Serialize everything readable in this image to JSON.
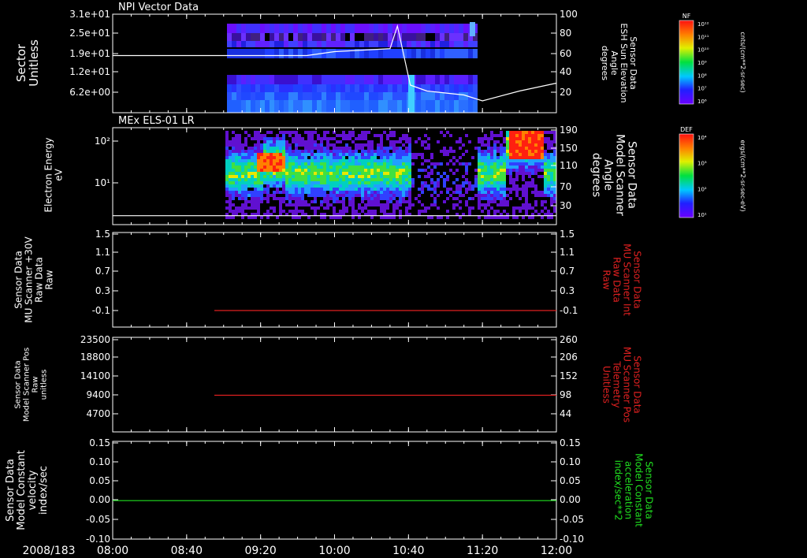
{
  "chart_data": [
    {
      "type": "heatmap",
      "title": "NPI Vector Data",
      "ylabel": [
        "Sector",
        "Unitless"
      ],
      "yticks": [
        "3.1e+01",
        "2.5e+01",
        "1.9e+01",
        "1.2e+01",
        "6.2e+00"
      ],
      "y2label": [
        "Sensor Data",
        "ESH Sun Elevation",
        "Angle",
        "degrees"
      ],
      "y2ticks": [
        "100",
        "80",
        "60",
        "40",
        "20"
      ],
      "ylim2": [
        0,
        100
      ],
      "colorbar": {
        "title": "NF",
        "unit": "cnts/(cm**2-sr-sec)",
        "ticks": [
          "10¹²",
          "10¹¹",
          "10¹⁰",
          "10⁹",
          "10⁸",
          "10⁷",
          "10⁶"
        ]
      },
      "series": [
        {
          "kind": "line",
          "x": [
            "08:00",
            "09:45",
            "10:00",
            "10:30",
            "10:34",
            "10:41",
            "10:50",
            "11:10",
            "11:20",
            "11:40",
            "12:00"
          ],
          "values": [
            58,
            58,
            62,
            65,
            88,
            28,
            22,
            18,
            12,
            22,
            30
          ]
        }
      ]
    },
    {
      "type": "heatmap",
      "title": "MEx ELS-01 LR",
      "ylabel": [
        "Electron Energy",
        "eV"
      ],
      "yticks": [
        "10²",
        "10¹"
      ],
      "y2label": [
        "Sensor Data",
        "Model Scanner",
        "Angle",
        "degrees"
      ],
      "y2ticks": [
        "190",
        "150",
        "110",
        "70",
        "30"
      ],
      "ylim2": [
        0,
        190
      ],
      "colorbar": {
        "title": "DEF",
        "unit": "ergs/(cm**2-sr-sec-eV)",
        "ticks": [
          "10⁴",
          "10³",
          "10²",
          "10¹"
        ]
      },
      "series": [
        {
          "kind": "line",
          "x": [
            "08:00",
            "12:00"
          ],
          "values": [
            2,
            2
          ]
        }
      ]
    },
    {
      "type": "line",
      "ylabel": [
        "Sensor Data",
        "MU Scanner +30V",
        "Raw Data",
        "Raw"
      ],
      "yticks": [
        "1.5",
        "1.1",
        "0.7",
        "0.3",
        "-0.1"
      ],
      "ylim": [
        -0.5,
        1.5
      ],
      "y2label": [
        "Sensor Data",
        "MU Scanner Int",
        "Raw Data",
        "Raw"
      ],
      "y2ticks": [
        "1.5",
        "1.1",
        "0.7",
        "0.3",
        "-0.1"
      ],
      "series": [
        {
          "kind": "line",
          "color": "#e02020",
          "x": [
            "08:55",
            "12:00"
          ],
          "values": [
            -0.1,
            -0.1
          ]
        }
      ]
    },
    {
      "type": "line",
      "ylabel": [
        "Sensor Data",
        "Model Scanner Pos",
        "Raw",
        "unitless"
      ],
      "yticks": [
        "23500",
        "18800",
        "14100",
        "9400",
        "4700"
      ],
      "ylim": [
        0,
        23500
      ],
      "y2label": [
        "Sensor Data",
        "MU Scanner Pos",
        "Telemetry",
        "Unitless"
      ],
      "y2ticks": [
        "260",
        "206",
        "152",
        "98",
        "44"
      ],
      "ylim2": [
        -10,
        260
      ],
      "series": [
        {
          "kind": "line",
          "color": "#e02020",
          "x": [
            "08:55",
            "12:00"
          ],
          "values2": [
            98,
            98
          ]
        }
      ]
    },
    {
      "type": "line",
      "ylabel": [
        "Sensor Data",
        "Model Constant",
        "velocity",
        "index/sec"
      ],
      "yticks": [
        "0.15",
        "0.10",
        "0.05",
        "0.00",
        "-0.05",
        "-0.10"
      ],
      "ylim": [
        -0.1,
        0.15
      ],
      "y2label": [
        "Sensor Data",
        "Model Constant",
        "acceleration",
        "index/sec**2"
      ],
      "y2ticks": [
        "0.15",
        "0.10",
        "0.05",
        "0.00",
        "-0.05",
        "-0.10"
      ],
      "series": [
        {
          "kind": "line",
          "color": "#20e020",
          "x": [
            "08:00",
            "12:00"
          ],
          "values": [
            0,
            0
          ]
        }
      ]
    }
  ],
  "xaxis": {
    "date": "2008/183",
    "ticks": [
      "08:00",
      "08:40",
      "09:20",
      "10:00",
      "10:40",
      "11:20",
      "12:00"
    ]
  },
  "colors": {
    "red_label": "#e02020",
    "green_label": "#20e020"
  }
}
